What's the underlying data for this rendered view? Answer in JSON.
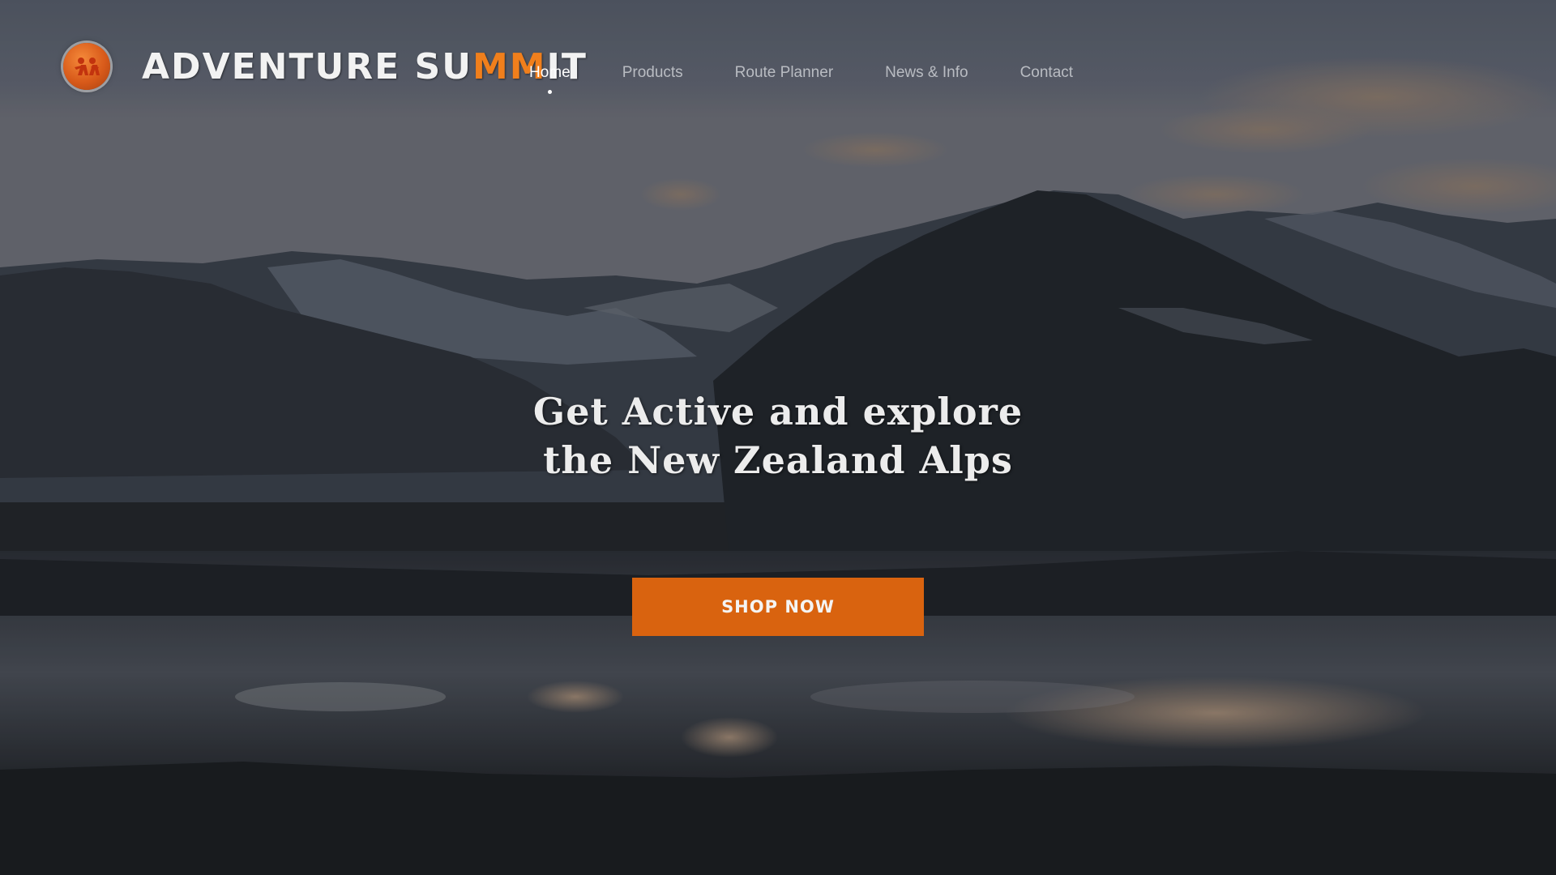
{
  "header": {
    "logo_text_start": "ADVENTURE SU",
    "logo_text_accent": "MM",
    "logo_text_end": "IT"
  },
  "nav": {
    "items": [
      {
        "label": "Home",
        "active": true
      },
      {
        "label": "Products",
        "active": false
      },
      {
        "label": "Route Planner",
        "active": false
      },
      {
        "label": "News & Info",
        "active": false
      },
      {
        "label": "Contact",
        "active": false
      }
    ]
  },
  "hero": {
    "headline_line1": "Get Active and explore",
    "headline_line2": "the New Zealand Alps",
    "cta_label": "SHOP NOW"
  },
  "colors": {
    "accent": "#d9630f",
    "logo_accent": "#f07f1c",
    "nav_active": "#ffffff",
    "nav_inactive": "#b9bcc2"
  },
  "icons": {
    "logo": "climbers-logo-icon"
  }
}
